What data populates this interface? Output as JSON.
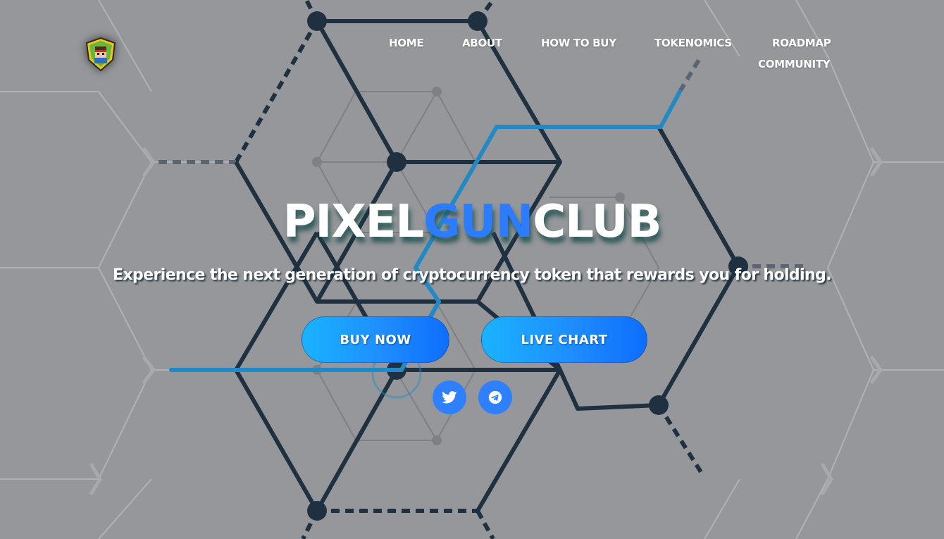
{
  "nav": {
    "items": [
      {
        "label": "HOME"
      },
      {
        "label": "ABOUT"
      },
      {
        "label": "HOW TO BUY"
      },
      {
        "label": "TOKENOMICS"
      },
      {
        "label": "ROADMAP"
      },
      {
        "label": "COMMUNITY"
      }
    ]
  },
  "hero": {
    "title_part1": "PIXEL",
    "title_part2": "GUN",
    "title_part3": "CLUB",
    "tagline": "Experience the next generation of cryptocurrency token that rewards you for holding."
  },
  "buttons": {
    "buy_now": "BUY NOW",
    "live_chart": "LIVE CHART"
  },
  "social": {
    "twitter_icon": "twitter-icon",
    "telegram_icon": "telegram-icon"
  },
  "colors": {
    "background": "#96979a",
    "accent": "#2b7cff",
    "button_gradient_start": "#19b3ff",
    "button_gradient_end": "#0d6efd",
    "network_lines": "#1f3140",
    "highlight_line": "#2389c4"
  }
}
